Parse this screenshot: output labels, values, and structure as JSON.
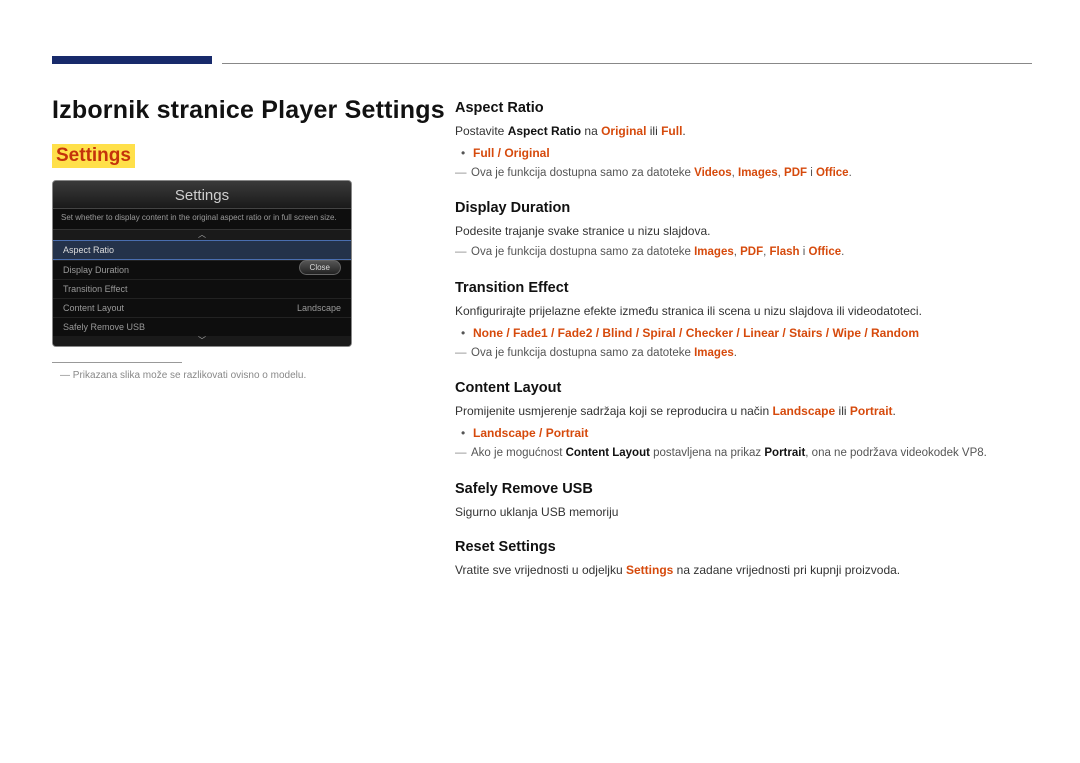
{
  "page": {
    "title": "Izbornik stranice Player Settings",
    "settings_label": "Settings"
  },
  "mock": {
    "title": "Settings",
    "desc": "Set whether to display content in the original aspect ratio or in full screen size.",
    "rows": {
      "aspect_ratio": "Aspect Ratio",
      "display_duration": "Display Duration",
      "transition_effect": "Transition Effect",
      "content_layout": "Content Layout",
      "content_layout_val": "Landscape",
      "safely_remove": "Safely Remove USB"
    },
    "close": "Close",
    "caption": "Prikazana slika može se razlikovati ovisno o modelu."
  },
  "aspect": {
    "h": "Aspect Ratio",
    "p1a": "Postavite ",
    "p1b": "Aspect Ratio",
    "p1c": " na ",
    "p1d": "Original",
    "p1e": " ili ",
    "p1f": "Full",
    "p1g": ".",
    "li": "Full / Original",
    "note_a": "Ova je funkcija dostupna samo za datoteke ",
    "note_b": "Videos",
    "note_c": ", ",
    "note_d": "Images",
    "note_e": ", ",
    "note_f": "PDF",
    "note_g": " i ",
    "note_h": "Office",
    "note_i": "."
  },
  "duration": {
    "h": "Display Duration",
    "p": "Podesite trajanje svake stranice u nizu slajdova.",
    "note_a": "Ova je funkcija dostupna samo za datoteke ",
    "note_b": "Images",
    "note_c": ", ",
    "note_d": "PDF",
    "note_e": ", ",
    "note_f": "Flash",
    "note_g": " i ",
    "note_h": "Office",
    "note_i": "."
  },
  "transition": {
    "h": "Transition Effect",
    "p": "Konfigurirajte prijelazne efekte između stranica ili scena u nizu slajdova ili videodatoteci.",
    "li": "None / Fade1 / Fade2 / Blind / Spiral / Checker / Linear / Stairs / Wipe / Random",
    "note_a": "Ova je funkcija dostupna samo za datoteke ",
    "note_b": "Images",
    "note_c": "."
  },
  "layout": {
    "h": "Content Layout",
    "p_a": "Promijenite usmjerenje sadržaja koji se reproducira u način ",
    "p_b": "Landscape",
    "p_c": " ili ",
    "p_d": "Portrait",
    "p_e": ".",
    "li": "Landscape / Portrait",
    "note_a": "Ako je mogućnost ",
    "note_b": "Content Layout",
    "note_c": " postavljena na prikaz ",
    "note_d": "Portrait",
    "note_e": ", ona ne podržava videokodek VP8."
  },
  "usb": {
    "h": "Safely Remove USB",
    "p": "Sigurno uklanja USB memoriju"
  },
  "reset": {
    "h": "Reset Settings",
    "p_a": "Vratite sve vrijednosti u odjeljku ",
    "p_b": "Settings",
    "p_c": " na zadane vrijednosti pri kupnji proizvoda."
  }
}
